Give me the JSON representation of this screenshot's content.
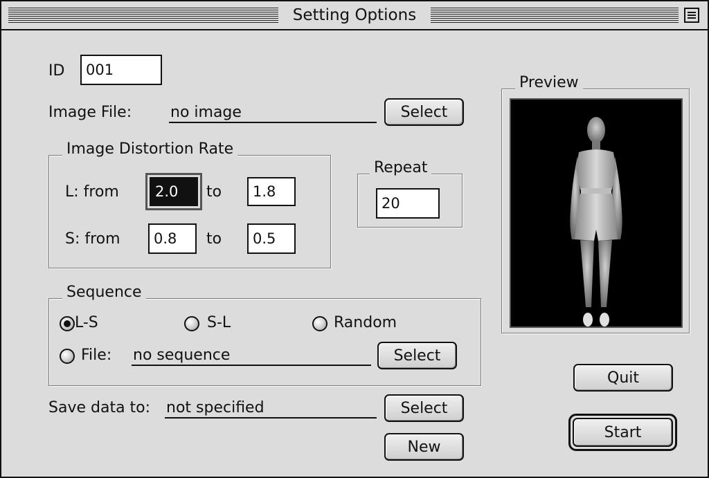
{
  "window": {
    "title": "Setting Options"
  },
  "id": {
    "label": "ID",
    "value": "001"
  },
  "image_file": {
    "label": "Image File:",
    "value": "no image",
    "select_label": "Select"
  },
  "distortion": {
    "title": "Image Distortion Rate",
    "l_label": "L:  from",
    "l_from": "2.0",
    "l_to_label": "to",
    "l_to": "1.8",
    "s_label": "S:  from",
    "s_from": "0.8",
    "s_to_label": "to",
    "s_to": "0.5"
  },
  "repeat": {
    "title": "Repeat",
    "value": "20"
  },
  "preview": {
    "title": "Preview",
    "image": "standing-woman-figure"
  },
  "sequence": {
    "title": "Sequence",
    "options": [
      {
        "label": "L-S",
        "selected": true
      },
      {
        "label": "S-L",
        "selected": false
      },
      {
        "label": "Random",
        "selected": false
      }
    ],
    "file_label": "File:",
    "file_value": "no sequence",
    "select_label": "Select"
  },
  "save": {
    "label": "Save data to:",
    "value": "not specified",
    "select_label": "Select",
    "new_label": "New"
  },
  "actions": {
    "quit_label": "Quit",
    "start_label": "Start"
  }
}
